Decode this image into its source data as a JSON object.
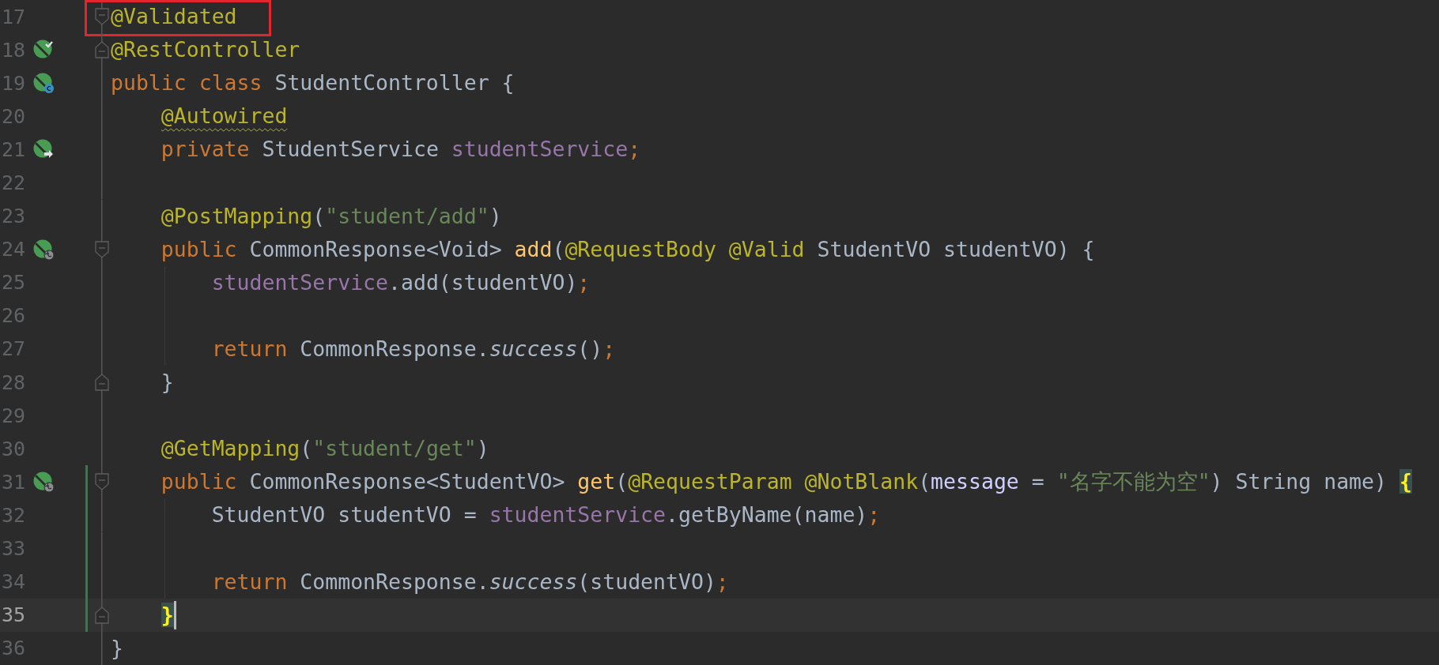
{
  "editor": {
    "lines": [
      {
        "number": "17",
        "fold_marker": {
          "kind": "start"
        },
        "changed": false,
        "current": false,
        "guide": false,
        "boxed": true,
        "tokens": [
          {
            "text": "@Validated",
            "kind": "annotation"
          }
        ]
      },
      {
        "number": "18",
        "gutter_icon": {
          "kind": "bean-check"
        },
        "fold_marker": {
          "kind": "end"
        },
        "changed": false,
        "current": false,
        "guide": false,
        "boxed": false,
        "tokens": [
          {
            "text": "@RestController",
            "kind": "annotation"
          }
        ]
      },
      {
        "number": "19",
        "gutter_icon": {
          "kind": "bean-class"
        },
        "changed": false,
        "current": false,
        "guide": false,
        "boxed": false,
        "tokens": [
          {
            "text": "public class ",
            "kind": "keyword"
          },
          {
            "text": "StudentController {",
            "kind": "plain"
          }
        ]
      },
      {
        "number": "20",
        "changed": false,
        "current": false,
        "guide": false,
        "boxed": false,
        "tokens": [
          {
            "text": "    @Autowired",
            "kind": "annotation-warning"
          }
        ]
      },
      {
        "number": "21",
        "gutter_icon": {
          "kind": "bean-arrow"
        },
        "changed": false,
        "current": false,
        "guide": false,
        "boxed": false,
        "tokens": [
          {
            "text": "    private ",
            "kind": "keyword"
          },
          {
            "text": "StudentService ",
            "kind": "plain"
          },
          {
            "text": "studentService",
            "kind": "field"
          },
          {
            "text": ";",
            "kind": "keyword"
          }
        ]
      },
      {
        "number": "22",
        "changed": false,
        "current": false,
        "guide": false,
        "boxed": false
      },
      {
        "number": "23",
        "changed": false,
        "current": false,
        "guide": false,
        "boxed": false,
        "tokens": [
          {
            "text": "    @PostMapping",
            "kind": "annotation"
          },
          {
            "text": "(",
            "kind": "plain"
          },
          {
            "text": "\"student/add\"",
            "kind": "string"
          },
          {
            "text": ")",
            "kind": "plain"
          }
        ]
      },
      {
        "number": "24",
        "gutter_icon": {
          "kind": "bean-globe"
        },
        "fold_marker": {
          "kind": "start"
        },
        "changed": false,
        "current": false,
        "guide": false,
        "boxed": false,
        "tokens": [
          {
            "text": "    public ",
            "kind": "keyword"
          },
          {
            "text": "CommonResponse<Void> ",
            "kind": "plain"
          },
          {
            "text": "add",
            "kind": "method"
          },
          {
            "text": "(",
            "kind": "plain"
          },
          {
            "text": "@RequestBody @Valid",
            "kind": "annotation"
          },
          {
            "text": " StudentVO studentVO) {",
            "kind": "plain"
          }
        ]
      },
      {
        "number": "25",
        "changed": false,
        "current": false,
        "guide": true,
        "boxed": false,
        "tokens": [
          {
            "text": "        studentService",
            "kind": "field"
          },
          {
            "text": ".add(studentVO)",
            "kind": "plain"
          },
          {
            "text": ";",
            "kind": "keyword"
          }
        ]
      },
      {
        "number": "26",
        "changed": false,
        "current": false,
        "guide": true,
        "boxed": false
      },
      {
        "number": "27",
        "changed": false,
        "current": false,
        "guide": true,
        "boxed": false,
        "tokens": [
          {
            "text": "        return ",
            "kind": "keyword"
          },
          {
            "text": "CommonResponse.",
            "kind": "plain"
          },
          {
            "text": "success",
            "kind": "static"
          },
          {
            "text": "()",
            "kind": "plain"
          },
          {
            "text": ";",
            "kind": "keyword"
          }
        ]
      },
      {
        "number": "28",
        "fold_marker": {
          "kind": "end"
        },
        "changed": false,
        "current": false,
        "guide": false,
        "boxed": false,
        "tokens": [
          {
            "text": "    }",
            "kind": "plain"
          }
        ]
      },
      {
        "number": "29",
        "changed": false,
        "current": false,
        "guide": false,
        "boxed": false
      },
      {
        "number": "30",
        "changed": false,
        "current": false,
        "guide": false,
        "boxed": false,
        "tokens": [
          {
            "text": "    @GetMapping",
            "kind": "annotation"
          },
          {
            "text": "(",
            "kind": "plain"
          },
          {
            "text": "\"student/get\"",
            "kind": "string"
          },
          {
            "text": ")",
            "kind": "plain"
          }
        ]
      },
      {
        "number": "31",
        "gutter_icon": {
          "kind": "bean-globe"
        },
        "fold_marker": {
          "kind": "start"
        },
        "changed": true,
        "current": false,
        "guide": false,
        "boxed": false,
        "tokens": [
          {
            "text": "    public ",
            "kind": "keyword"
          },
          {
            "text": "CommonResponse<StudentVO> ",
            "kind": "plain"
          },
          {
            "text": "get",
            "kind": "method"
          },
          {
            "text": "(",
            "kind": "plain"
          },
          {
            "text": "@RequestParam @NotBlank",
            "kind": "annotation"
          },
          {
            "text": "(",
            "kind": "plain"
          },
          {
            "text": "message",
            "kind": "param"
          },
          {
            "text": " = ",
            "kind": "plain"
          },
          {
            "text": "\"名字不能为空\"",
            "kind": "string"
          },
          {
            "text": ") String name) ",
            "kind": "plain"
          },
          {
            "text": "{",
            "kind": "brace-match"
          }
        ]
      },
      {
        "number": "32",
        "changed": true,
        "current": false,
        "guide": true,
        "boxed": false,
        "tokens": [
          {
            "text": "        StudentVO studentVO = ",
            "kind": "plain"
          },
          {
            "text": "studentService",
            "kind": "field"
          },
          {
            "text": ".getByName(name)",
            "kind": "plain"
          },
          {
            "text": ";",
            "kind": "keyword"
          }
        ]
      },
      {
        "number": "33",
        "changed": true,
        "current": false,
        "guide": true,
        "boxed": false
      },
      {
        "number": "34",
        "changed": true,
        "current": false,
        "guide": true,
        "boxed": false,
        "tokens": [
          {
            "text": "        return ",
            "kind": "keyword"
          },
          {
            "text": "CommonResponse.",
            "kind": "plain"
          },
          {
            "text": "success",
            "kind": "static"
          },
          {
            "text": "(studentVO)",
            "kind": "plain"
          },
          {
            "text": ";",
            "kind": "keyword"
          }
        ]
      },
      {
        "number": "35",
        "fold_marker": {
          "kind": "end"
        },
        "changed": true,
        "current": true,
        "guide": false,
        "boxed": false,
        "tokens": [
          {
            "text": "    }",
            "kind": "brace-match"
          }
        ]
      },
      {
        "number": "36",
        "changed": false,
        "current": false,
        "guide": false,
        "boxed": false,
        "tokens": [
          {
            "text": "}",
            "kind": "plain"
          }
        ]
      }
    ]
  }
}
